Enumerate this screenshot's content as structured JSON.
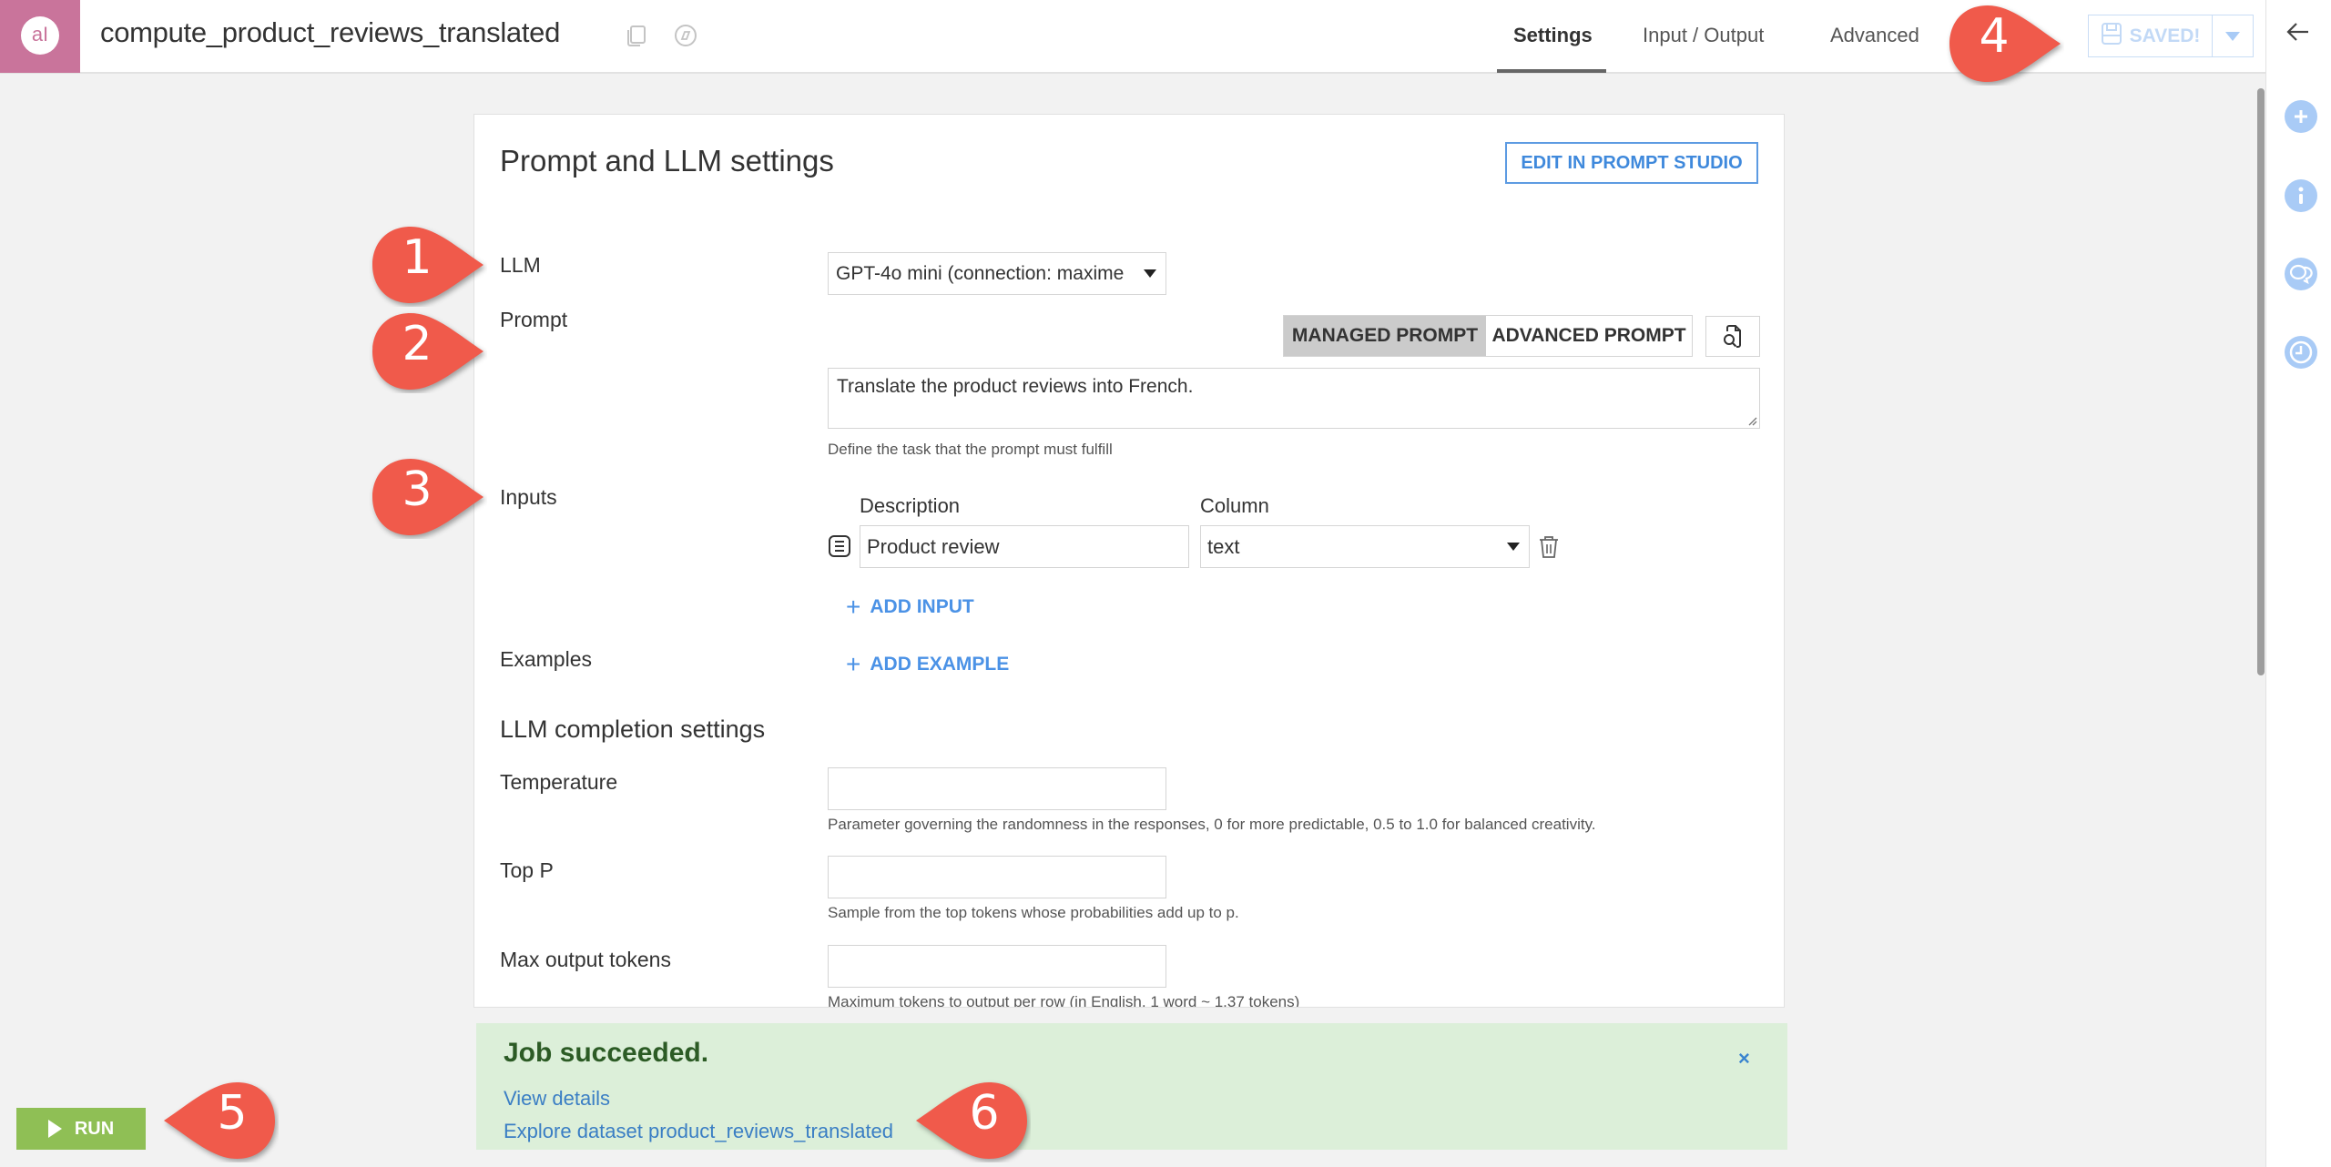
{
  "header": {
    "app_logo": "dataiku-ai-icon",
    "logo_text": "aI",
    "recipe_name": "compute_product_reviews_translated",
    "icons": [
      "copy-icon",
      "compass-icon"
    ],
    "tabs": [
      {
        "label": "Settings",
        "active": true
      },
      {
        "label": "Input / Output",
        "active": false
      },
      {
        "label": "Advanced",
        "active": false
      }
    ],
    "save_label": "SAVED!",
    "save_icon": "floppy-disk-icon"
  },
  "right_sidebar": {
    "back_icon": "arrow-left-icon",
    "icons": [
      "plus-icon",
      "info-icon",
      "discussions-icon",
      "history-clock-icon"
    ]
  },
  "card": {
    "title": "Prompt and LLM settings",
    "edit_button": "EDIT IN PROMPT STUDIO",
    "llm": {
      "label": "LLM",
      "value": "GPT-4o mini (connection: maxime"
    },
    "prompt": {
      "label": "Prompt",
      "modes": [
        {
          "label": "MANAGED PROMPT",
          "selected": true
        },
        {
          "label": "ADVANCED PROMPT",
          "selected": false
        }
      ],
      "preview_icon": "document-search-icon",
      "text": "Translate the product reviews into French.",
      "help": "Define the task that the prompt must fulfill"
    },
    "inputs": {
      "label": "Inputs",
      "col_description": "Description",
      "col_column": "Column",
      "rows": [
        {
          "description": "Product review",
          "column": "text"
        }
      ],
      "add_label": "ADD INPUT"
    },
    "examples": {
      "label": "Examples",
      "add_label": "ADD EXAMPLE"
    },
    "completion": {
      "title": "LLM completion settings",
      "temperature": {
        "label": "Temperature",
        "value": "",
        "help": "Parameter governing the randomness in the responses, 0 for more predictable, 0.5 to 1.0 for balanced creativity."
      },
      "top_p": {
        "label": "Top P",
        "value": "",
        "help": "Sample from the top tokens whose probabilities add up to p."
      },
      "max_tokens": {
        "label": "Max output tokens",
        "value": "",
        "help": "Maximum tokens to output per row (in English, 1 word ~ 1.37 tokens)"
      }
    }
  },
  "notification": {
    "title": "Job succeeded.",
    "view_details": "View details",
    "explore": "Explore dataset product_reviews_translated",
    "close": "×"
  },
  "run_button": "RUN",
  "markers": [
    "1",
    "2",
    "3",
    "4",
    "5",
    "6"
  ],
  "colors": {
    "brand": "#c9749b",
    "accent": "#4b92e6",
    "success_bg": "#dcefd9",
    "run": "#8fbf55",
    "marker": "#f05a4b"
  }
}
